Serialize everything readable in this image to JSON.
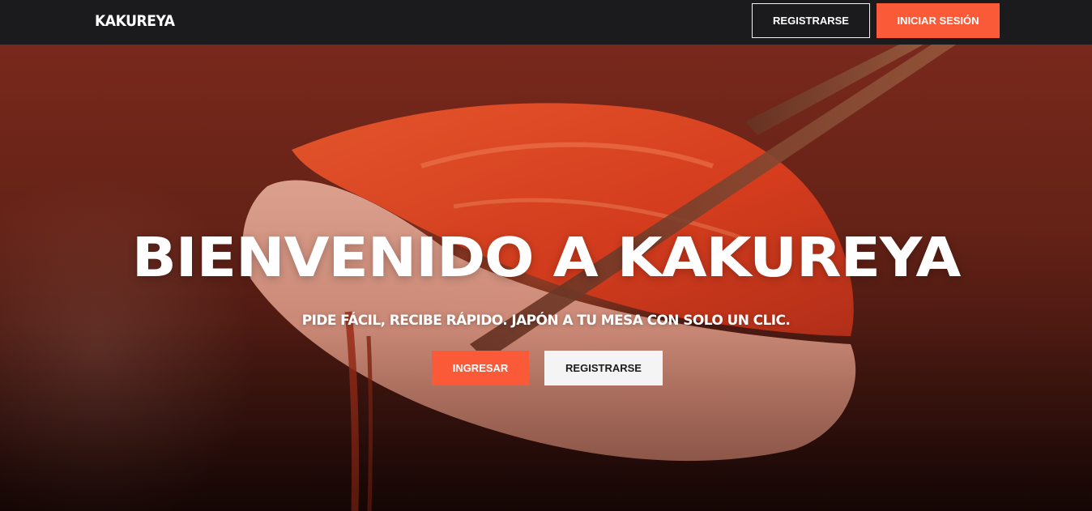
{
  "header": {
    "logo_text": "KAKUREYA",
    "register_label": "REGISTRARSE",
    "login_label": "INICIAR SESIÓN"
  },
  "hero": {
    "title": "BIENVENIDO A KAKUREYA",
    "subtitle": "PIDE FÁCIL, RECIBE RÁPIDO. JAPÓN A TU MESA CON SOLO UN CLIC.",
    "enter_label": "INGRESAR",
    "register_label": "REGISTRARSE",
    "background_image": "sushi-nigiri-chopsticks-image"
  },
  "colors": {
    "accent": "#fa5a37",
    "topbar": "#1b1b1d",
    "hero_base": "#6a2418"
  }
}
